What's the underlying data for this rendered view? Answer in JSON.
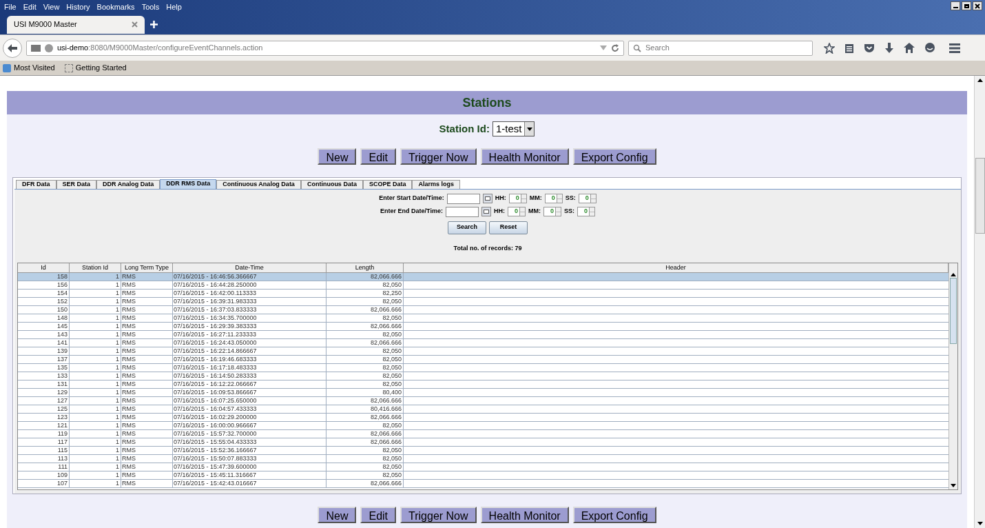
{
  "menu_bar": [
    "File",
    "Edit",
    "View",
    "History",
    "Bookmarks",
    "Tools",
    "Help"
  ],
  "browser_tabs": [
    {
      "label": "USI M9000 Master",
      "selected": true
    }
  ],
  "address_bar": {
    "host": "usi-demo",
    "path": ":8080/M9000Master/configureEventChannels.action"
  },
  "search_box": {
    "placeholder": "Search"
  },
  "bookmarks": [
    "Most Visited",
    "Getting Started"
  ],
  "page": {
    "title": "Stations",
    "station_label": "Station Id:",
    "station_value": "1-test",
    "buttons": [
      "New",
      "Edit",
      "Trigger Now",
      "Health Monitor",
      "Export Config"
    ],
    "bottom_buttons": [
      "New",
      "Edit",
      "Trigger Now",
      "Health Monitor",
      "Export Config"
    ],
    "tabs": [
      {
        "label": "DFR Data",
        "selected": false
      },
      {
        "label": "SER Data",
        "selected": false
      },
      {
        "label": "DDR Analog Data",
        "selected": false
      },
      {
        "label": "DDR RMS Data",
        "selected": true
      },
      {
        "label": "Continuous Analog Data",
        "selected": false
      },
      {
        "label": "Continuous Data",
        "selected": false
      },
      {
        "label": "SCOPE Data",
        "selected": false
      },
      {
        "label": "Alarms logs",
        "selected": false
      }
    ],
    "filters": [
      {
        "label": "Enter Start Date/Time:",
        "hh_label": "HH:",
        "hh": "0",
        "mm_label": "MM:",
        "mm": "0",
        "ss_label": "SS:",
        "ss": "0"
      },
      {
        "label": "Enter End Date/Time:",
        "hh_label": "HH:",
        "hh": "0",
        "mm_label": "MM:",
        "mm": "0",
        "ss_label": "SS:",
        "ss": "0"
      }
    ],
    "filter_buttons": [
      "Search",
      "Reset"
    ],
    "total": "Total no. of records: 79",
    "table": {
      "columns": [
        "Id",
        "Station Id",
        "Long Term Type",
        "Date-Time",
        "Length",
        "Header"
      ],
      "rows": [
        {
          "cells": [
            "158",
            "1",
            "RMS",
            "07/16/2015 - 16:46:56.366667",
            "82,066.666"
          ],
          "selected": true
        },
        {
          "cells": [
            "156",
            "1",
            "RMS",
            "07/16/2015 - 16:44:28.250000",
            "82,050"
          ],
          "selected": false
        },
        {
          "cells": [
            "154",
            "1",
            "RMS",
            "07/16/2015 - 16:42:00.113333",
            "82,250"
          ],
          "selected": false
        },
        {
          "cells": [
            "152",
            "1",
            "RMS",
            "07/16/2015 - 16:39:31.983333",
            "82,050"
          ],
          "selected": false
        },
        {
          "cells": [
            "150",
            "1",
            "RMS",
            "07/16/2015 - 16:37:03.833333",
            "82,066.666"
          ],
          "selected": false
        },
        {
          "cells": [
            "148",
            "1",
            "RMS",
            "07/16/2015 - 16:34:35.700000",
            "82,050"
          ],
          "selected": false
        },
        {
          "cells": [
            "145",
            "1",
            "RMS",
            "07/16/2015 - 16:29:39.383333",
            "82,066.666"
          ],
          "selected": false
        },
        {
          "cells": [
            "143",
            "1",
            "RMS",
            "07/16/2015 - 16:27:11.233333",
            "82,050"
          ],
          "selected": false
        },
        {
          "cells": [
            "141",
            "1",
            "RMS",
            "07/16/2015 - 16:24:43.050000",
            "82,066.666"
          ],
          "selected": false
        },
        {
          "cells": [
            "139",
            "1",
            "RMS",
            "07/16/2015 - 16:22:14.866667",
            "82,050"
          ],
          "selected": false
        },
        {
          "cells": [
            "137",
            "1",
            "RMS",
            "07/16/2015 - 16:19:46.683333",
            "82,050"
          ],
          "selected": false
        },
        {
          "cells": [
            "135",
            "1",
            "RMS",
            "07/16/2015 - 16:17:18.483333",
            "82,050"
          ],
          "selected": false
        },
        {
          "cells": [
            "133",
            "1",
            "RMS",
            "07/16/2015 - 16:14:50.283333",
            "82,050"
          ],
          "selected": false
        },
        {
          "cells": [
            "131",
            "1",
            "RMS",
            "07/16/2015 - 16:12:22.066667",
            "82,050"
          ],
          "selected": false
        },
        {
          "cells": [
            "129",
            "1",
            "RMS",
            "07/16/2015 - 16:09:53.866667",
            "80,400"
          ],
          "selected": false
        },
        {
          "cells": [
            "127",
            "1",
            "RMS",
            "07/16/2015 - 16:07:25.650000",
            "82,066.666"
          ],
          "selected": false
        },
        {
          "cells": [
            "125",
            "1",
            "RMS",
            "07/16/2015 - 16:04:57.433333",
            "80,416.666"
          ],
          "selected": false
        },
        {
          "cells": [
            "123",
            "1",
            "RMS",
            "07/16/2015 - 16:02:29.200000",
            "82,066.666"
          ],
          "selected": false
        },
        {
          "cells": [
            "121",
            "1",
            "RMS",
            "07/16/2015 - 16:00:00.966667",
            "82,050"
          ],
          "selected": false
        },
        {
          "cells": [
            "119",
            "1",
            "RMS",
            "07/16/2015 - 15:57:32.700000",
            "82,066.666"
          ],
          "selected": false
        },
        {
          "cells": [
            "117",
            "1",
            "RMS",
            "07/16/2015 - 15:55:04.433333",
            "82,066.666"
          ],
          "selected": false
        },
        {
          "cells": [
            "115",
            "1",
            "RMS",
            "07/16/2015 - 15:52:36.166667",
            "82,050"
          ],
          "selected": false
        },
        {
          "cells": [
            "113",
            "1",
            "RMS",
            "07/16/2015 - 15:50:07.883333",
            "82,050"
          ],
          "selected": false
        },
        {
          "cells": [
            "111",
            "1",
            "RMS",
            "07/16/2015 - 15:47:39.600000",
            "82,050"
          ],
          "selected": false
        },
        {
          "cells": [
            "109",
            "1",
            "RMS",
            "07/16/2015 - 15:45:11.316667",
            "82,050"
          ],
          "selected": false
        },
        {
          "cells": [
            "107",
            "1",
            "RMS",
            "07/16/2015 - 15:42:43.016667",
            "82,066.666"
          ],
          "selected": false
        }
      ]
    }
  }
}
